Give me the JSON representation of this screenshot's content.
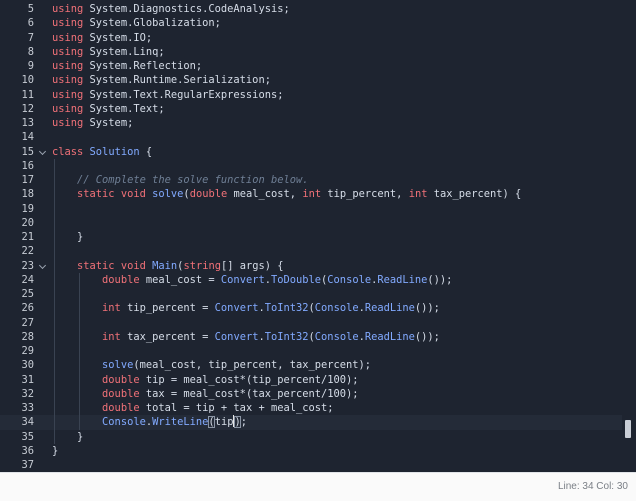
{
  "editor": {
    "lines": [
      {
        "num": "5",
        "tokens": [
          {
            "t": "using",
            "c": "kw"
          },
          {
            "t": " System.Diagnostics.CodeAnalysis;"
          }
        ]
      },
      {
        "num": "6",
        "tokens": [
          {
            "t": "using",
            "c": "kw"
          },
          {
            "t": " System.Globalization;"
          }
        ]
      },
      {
        "num": "7",
        "tokens": [
          {
            "t": "using",
            "c": "kw"
          },
          {
            "t": " System.IO;"
          }
        ]
      },
      {
        "num": "8",
        "tokens": [
          {
            "t": "using",
            "c": "kw"
          },
          {
            "t": " System.Linq;"
          }
        ]
      },
      {
        "num": "9",
        "tokens": [
          {
            "t": "using",
            "c": "kw"
          },
          {
            "t": " System.Reflection;"
          }
        ]
      },
      {
        "num": "10",
        "tokens": [
          {
            "t": "using",
            "c": "kw"
          },
          {
            "t": " System.Runtime.Serialization;"
          }
        ]
      },
      {
        "num": "11",
        "tokens": [
          {
            "t": "using",
            "c": "kw"
          },
          {
            "t": " System.Text.RegularExpressions;"
          }
        ]
      },
      {
        "num": "12",
        "tokens": [
          {
            "t": "using",
            "c": "kw"
          },
          {
            "t": " System.Text;"
          }
        ]
      },
      {
        "num": "13",
        "tokens": [
          {
            "t": "using",
            "c": "kw"
          },
          {
            "t": " System;"
          }
        ]
      },
      {
        "num": "14",
        "tokens": []
      },
      {
        "num": "15",
        "fold": true,
        "tokens": [
          {
            "t": "class",
            "c": "kw"
          },
          {
            "t": " "
          },
          {
            "t": "Solution",
            "c": "cls"
          },
          {
            "t": " {"
          }
        ]
      },
      {
        "num": "16",
        "tokens": []
      },
      {
        "num": "17",
        "tokens": [
          {
            "t": "    "
          },
          {
            "t": "// Complete the solve function below.",
            "c": "cm"
          }
        ]
      },
      {
        "num": "18",
        "tokens": [
          {
            "t": "    "
          },
          {
            "t": "static",
            "c": "kw"
          },
          {
            "t": " "
          },
          {
            "t": "void",
            "c": "kw"
          },
          {
            "t": " "
          },
          {
            "t": "solve",
            "c": "fn"
          },
          {
            "t": "("
          },
          {
            "t": "double",
            "c": "kw"
          },
          {
            "t": " meal_cost, "
          },
          {
            "t": "int",
            "c": "kw"
          },
          {
            "t": " tip_percent, "
          },
          {
            "t": "int",
            "c": "kw"
          },
          {
            "t": " tax_percent) {"
          }
        ]
      },
      {
        "num": "19",
        "tokens": []
      },
      {
        "num": "20",
        "tokens": []
      },
      {
        "num": "21",
        "tokens": [
          {
            "t": "    }"
          }
        ]
      },
      {
        "num": "22",
        "tokens": []
      },
      {
        "num": "23",
        "fold": true,
        "tokens": [
          {
            "t": "    "
          },
          {
            "t": "static",
            "c": "kw"
          },
          {
            "t": " "
          },
          {
            "t": "void",
            "c": "kw"
          },
          {
            "t": " "
          },
          {
            "t": "Main",
            "c": "fn"
          },
          {
            "t": "("
          },
          {
            "t": "string",
            "c": "kw"
          },
          {
            "t": "[] args) {"
          }
        ]
      },
      {
        "num": "24",
        "tokens": [
          {
            "t": "        "
          },
          {
            "t": "double",
            "c": "kw"
          },
          {
            "t": " meal_cost = "
          },
          {
            "t": "Convert",
            "c": "cls"
          },
          {
            "t": "."
          },
          {
            "t": "ToDouble",
            "c": "fn"
          },
          {
            "t": "("
          },
          {
            "t": "Console",
            "c": "cls"
          },
          {
            "t": "."
          },
          {
            "t": "ReadLine",
            "c": "fn"
          },
          {
            "t": "());"
          }
        ]
      },
      {
        "num": "25",
        "tokens": []
      },
      {
        "num": "26",
        "tokens": [
          {
            "t": "        "
          },
          {
            "t": "int",
            "c": "kw"
          },
          {
            "t": " tip_percent = "
          },
          {
            "t": "Convert",
            "c": "cls"
          },
          {
            "t": "."
          },
          {
            "t": "ToInt32",
            "c": "fn"
          },
          {
            "t": "("
          },
          {
            "t": "Console",
            "c": "cls"
          },
          {
            "t": "."
          },
          {
            "t": "ReadLine",
            "c": "fn"
          },
          {
            "t": "());"
          }
        ]
      },
      {
        "num": "27",
        "tokens": []
      },
      {
        "num": "28",
        "tokens": [
          {
            "t": "        "
          },
          {
            "t": "int",
            "c": "kw"
          },
          {
            "t": " tax_percent = "
          },
          {
            "t": "Convert",
            "c": "cls"
          },
          {
            "t": "."
          },
          {
            "t": "ToInt32",
            "c": "fn"
          },
          {
            "t": "("
          },
          {
            "t": "Console",
            "c": "cls"
          },
          {
            "t": "."
          },
          {
            "t": "ReadLine",
            "c": "fn"
          },
          {
            "t": "());"
          }
        ]
      },
      {
        "num": "29",
        "tokens": []
      },
      {
        "num": "30",
        "tokens": [
          {
            "t": "        "
          },
          {
            "t": "solve",
            "c": "fn"
          },
          {
            "t": "(meal_cost, tip_percent, tax_percent);"
          }
        ]
      },
      {
        "num": "31",
        "tokens": [
          {
            "t": "        "
          },
          {
            "t": "double",
            "c": "kw"
          },
          {
            "t": " tip = meal_cost*(tip_percent/100);"
          }
        ]
      },
      {
        "num": "32",
        "tokens": [
          {
            "t": "        "
          },
          {
            "t": "double",
            "c": "kw"
          },
          {
            "t": " tax = meal_cost*(tax_percent/100);"
          }
        ]
      },
      {
        "num": "33",
        "tokens": [
          {
            "t": "        "
          },
          {
            "t": "double",
            "c": "kw"
          },
          {
            "t": " total = tip + tax + meal_cost;"
          }
        ]
      },
      {
        "num": "34",
        "active": true,
        "tokens": [
          {
            "t": "        "
          },
          {
            "t": "Console",
            "c": "cls"
          },
          {
            "t": "."
          },
          {
            "t": "WriteLine",
            "c": "fn"
          },
          {
            "t": "(",
            "c": "br"
          },
          {
            "t": "tip",
            "cursorAfter": true
          },
          {
            "t": ")",
            "c": "br"
          },
          {
            "t": ";"
          }
        ]
      },
      {
        "num": "35",
        "tokens": [
          {
            "t": "    }"
          }
        ]
      },
      {
        "num": "36",
        "tokens": [
          {
            "t": "}"
          }
        ]
      },
      {
        "num": "37",
        "tokens": []
      }
    ]
  },
  "statusbar": {
    "position": "Line: 34 Col: 30"
  },
  "colors": {
    "background": "#1e2430",
    "keyword": "#f07178",
    "type_or_method": "#82aaff",
    "comment": "#6f7f95",
    "text": "#d6dde8",
    "line_number": "#c7ccd4"
  }
}
